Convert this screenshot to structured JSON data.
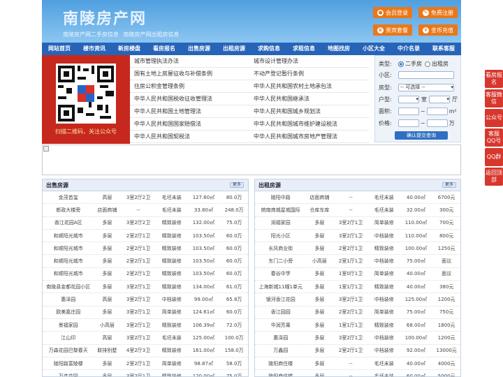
{
  "header": {
    "title": "南陵房产网",
    "subtitle": "南陵房产网二手房信息   南陵房产网出租房信息",
    "buttons": {
      "member_login": "会员登录",
      "free_register": "免费注册",
      "vip_package": "贵宾套餐",
      "gold_recharge": "金币充值"
    }
  },
  "nav": [
    "网站首页",
    "楼市资讯",
    "新房楼盘",
    "看房报名",
    "出售房源",
    "出租房源",
    "求购信息",
    "求租信息",
    "地图找房",
    "小区大全",
    "中介名录",
    "联系客服"
  ],
  "banner": {
    "qr_caption": "扫描二维码，关注公众号"
  },
  "links": {
    "left": [
      "城市管理执法办法",
      "国有土地上房屋征收与补偿条例",
      "住房公积金管理条例",
      "中华人民共和国税收征收管理法",
      "中华人民共和国土地管理法",
      "中华人民共和国国家赔偿法",
      "中华人民共和国契税法"
    ],
    "right": [
      "城市设计管理办法",
      "不动产登记暂行条例",
      "中华人民共和国农村土地承包法",
      "中华人民共和国继承法",
      "中华人民共和国城乡规划法",
      "中华人民共和国城市维护建设税法",
      "中华人民共和国城市房地产管理法"
    ]
  },
  "search": {
    "type_label": "类型:",
    "type_options": [
      "二手房",
      "出租房"
    ],
    "community_label": "小区:",
    "house_type_label": "房型:",
    "house_type_value": "-- 可选择 --",
    "layout_label": "户型:",
    "room_unit": "室",
    "hall_unit": "厅",
    "area_label": "面积:",
    "area_unit": "m²",
    "price_label": "价格:",
    "price_unit": "万",
    "range_sep": "~",
    "submit": "确认提交查询"
  },
  "sale": {
    "title": "出售房源",
    "more": "更多",
    "rows": [
      [
        "金茂首玺",
        "高层",
        "3室2厅2卫",
        "毛坯未装",
        "127.60㎡",
        "80.0万"
      ],
      [
        "郎政大楼旁",
        "店面商铺",
        "--",
        "毛坯未装",
        "33.80㎡",
        "248.0万"
      ],
      [
        "香江花园A区",
        "多层",
        "3室2厅2卫",
        "精致装修",
        "132.00㎡",
        "75.0万"
      ],
      [
        "和顺阳光城市",
        "多层",
        "2室2厅1卫",
        "精致装修",
        "103.50㎡",
        "60.0万"
      ],
      [
        "和顺阳光城市",
        "多层",
        "2室2厅1卫",
        "精致装修",
        "103.50㎡",
        "60.0万"
      ],
      [
        "和顺阳光城市",
        "多层",
        "2室2厅1卫",
        "精致装修",
        "103.50㎡",
        "60.0万"
      ],
      [
        "和顺阳光城市",
        "多层",
        "2室2厅1卫",
        "精致装修",
        "103.50㎡",
        "60.0万"
      ],
      [
        "南陵县金都花园小区",
        "多层",
        "3室2厅1卫",
        "精致装修",
        "134.00㎡",
        "61.0万"
      ],
      [
        "惠泽园",
        "高层",
        "3室2厅1卫",
        "中档装修",
        "99.00㎡",
        "65.8万"
      ],
      [
        "欧美嘉庄园",
        "多层",
        "3室2厅1卫",
        "简单装修",
        "124.61㎡",
        "60.0万"
      ],
      [
        "景福家园",
        "小高层",
        "3室2厅1卫",
        "精致装修",
        "106.39㎡",
        "72.0万"
      ],
      [
        "江山印",
        "高层",
        "3室2厅1卫",
        "毛坯未装",
        "125.00㎡",
        "100.0万"
      ],
      [
        "万森花园巴黎春天",
        "联排别墅",
        "4室2厅3卫",
        "精致装修",
        "161.00㎡",
        "158.0万"
      ],
      [
        "陵阳路富陵楼",
        "多层",
        "2室2厅1卫",
        "简单装修",
        "98.87㎡",
        "58.0万"
      ],
      [
        "万森花园",
        "多层",
        "3室2厅1卫",
        "精致装修",
        "120.00㎡",
        "75.0万"
      ]
    ]
  },
  "rent": {
    "title": "出租房源",
    "more": "更多",
    "rows": [
      [
        "陵阳中路",
        "店面商铺",
        "--",
        "毛坯未装",
        "40.00㎡",
        "6700元"
      ],
      [
        "皖南商城星城国际",
        "仓库车库",
        "--",
        "毛坯未装",
        "32.00㎡",
        "300元"
      ],
      [
        "润福家园",
        "多层",
        "3室2厅1卫",
        "简单装修",
        "110.00㎡",
        "700元"
      ],
      [
        "阳光小区",
        "多层",
        "3室2厅1卫",
        "中档装修",
        "110.00㎡",
        "800元"
      ],
      [
        "长风商业街",
        "多层",
        "2室2厅1卫",
        "精致装修",
        "100.00㎡",
        "1250元"
      ],
      [
        "东门二小旁",
        "小高层",
        "2室1厅1卫",
        "中档装修",
        "75.00㎡",
        "面议"
      ],
      [
        "春谷中学",
        "多层",
        "1室0厅1卫",
        "简单装修",
        "40.00㎡",
        "面议"
      ],
      [
        "上海新城11幢1单元",
        "多层",
        "1室1厅1卫",
        "精致装修",
        "40.00㎡",
        "380元"
      ],
      [
        "银河香江花园",
        "多层",
        "3室2厅1卫",
        "中档装修",
        "125.00㎡",
        "1200元"
      ],
      [
        "香江园园",
        "多层",
        "2室2厅1卫",
        "简单装修",
        "75.00㎡",
        "750元"
      ],
      [
        "华润芳果",
        "多层",
        "1室1厅1卫",
        "精致装修",
        "68.00㎡",
        "1800元"
      ],
      [
        "惠泽园",
        "多层",
        "3室2厅1卫",
        "中档装修",
        "100.00㎡",
        "1200元"
      ],
      [
        "万鑫园",
        "多层",
        "2室2厅1卫",
        "中档装修",
        "92.00㎡",
        "13000元"
      ],
      [
        "陵阳商住楼",
        "多层",
        "--",
        "毛坯未装",
        "40.00㎡",
        "4000元"
      ],
      [
        "陵阳商住楼",
        "多层",
        "--",
        "毛坯未装",
        "60.00㎡",
        "5000元"
      ]
    ]
  },
  "side_tabs": [
    "看房报名",
    "客服微信",
    "公众号",
    "客服QQ号",
    "QQ群",
    "返回顶部"
  ],
  "colors": {
    "nav": "#2764b8",
    "accent": "#e8781a",
    "side": "#d7372c",
    "qr_bg": "#c7281e"
  }
}
